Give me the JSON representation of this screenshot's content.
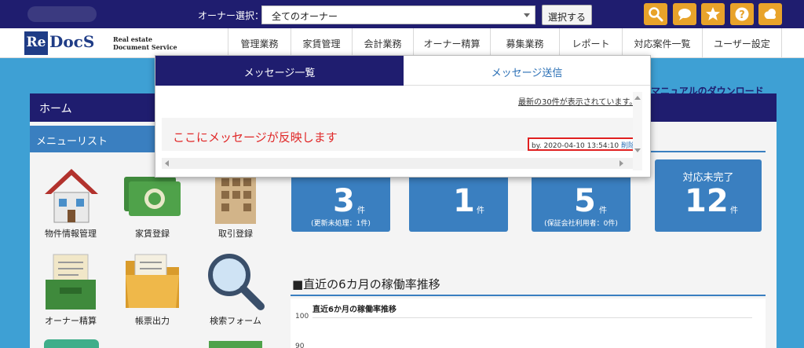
{
  "topbar": {
    "owner_label": "オーナー選択：",
    "owner_select_value": "全てのオーナー",
    "select_button": "選択する",
    "icons": [
      "search-icon",
      "chat-icon",
      "star-icon",
      "help-icon",
      "cloud-icon"
    ],
    "icon_color": "#e8a32a"
  },
  "logo": {
    "re": "Re",
    "docs": "DocS",
    "sub_line1": "Real estate",
    "sub_line2": "Document Service"
  },
  "nav": {
    "items": [
      "管理業務",
      "家賃管理",
      "会計業務",
      "オーナー精算",
      "募集業務",
      "レポート",
      "対応案件一覧",
      "ユーザー設定"
    ]
  },
  "manual_link": "マニュアルのダウンロード",
  "left": {
    "home": "ホーム",
    "menu_title": "メニューリスト",
    "menu_items": [
      {
        "label": "物件情報管理",
        "icon": "house-icon"
      },
      {
        "label": "家賃登録",
        "icon": "money-icon"
      },
      {
        "label": "取引登録",
        "icon": "building-icon"
      },
      {
        "label": "オーナー精算",
        "icon": "inbox-tray-icon"
      },
      {
        "label": "帳票出力",
        "icon": "folder-icon"
      },
      {
        "label": "検索フォーム",
        "icon": "magnifier-icon"
      }
    ]
  },
  "stats": [
    {
      "title": "",
      "num": "3",
      "unit": "件",
      "note": "(更新未処理：1件)"
    },
    {
      "title": "",
      "num": "1",
      "unit": "件",
      "note": ""
    },
    {
      "title": "",
      "num": "5",
      "unit": "件",
      "note": "(保証会社利用者：0件)"
    },
    {
      "title": "対応未完了",
      "num": "12",
      "unit": "件",
      "note": ""
    }
  ],
  "section_title": "■直近の6カ月の稼働率推移",
  "chart": {
    "title": "直近6か月の稼働率推移",
    "ticks": [
      "100",
      "90"
    ]
  },
  "modal": {
    "tab_active": "メッセージ一覧",
    "tab_inactive": "メッセージ送信",
    "count_text": "最新の30件が表示されています。",
    "message_text": "ここにメッセージが反映します",
    "meta_by": "by. 2020-04-10 13:54:10",
    "meta_delete": "削除"
  },
  "colors": {
    "navy": "#1f1d6f",
    "blue": "#3a7fc0",
    "background": "#3ea0d4",
    "accent_orange": "#e8a32a",
    "alert_red": "#e02828"
  }
}
